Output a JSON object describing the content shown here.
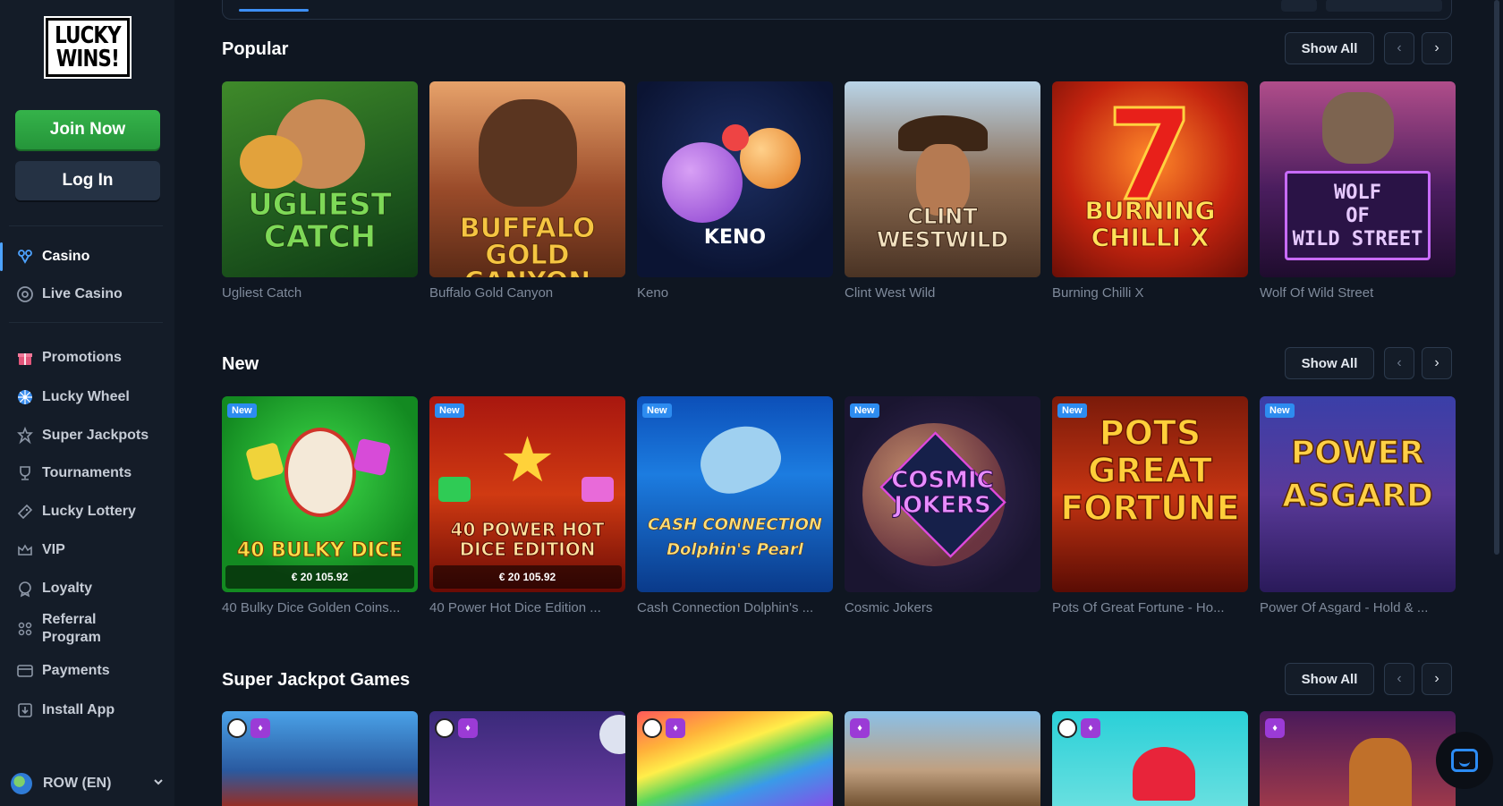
{
  "brand": {
    "logo_line1": "LUCKY",
    "logo_line2": "WINS!"
  },
  "auth": {
    "join_label": "Join Now",
    "login_label": "Log In"
  },
  "sidebar": {
    "primary": [
      {
        "label": "Casino",
        "icon": "casino-icon",
        "active": true
      },
      {
        "label": "Live Casino",
        "icon": "live-casino-icon",
        "active": false
      }
    ],
    "secondary": [
      {
        "label": "Promotions",
        "icon": "gift-icon"
      },
      {
        "label": "Lucky Wheel",
        "icon": "wheel-icon"
      },
      {
        "label": "Super Jackpots",
        "icon": "jackpot-icon"
      },
      {
        "label": "Tournaments",
        "icon": "trophy-icon"
      },
      {
        "label": "Lucky Lottery",
        "icon": "ticket-icon"
      },
      {
        "label": "VIP",
        "icon": "crown-icon"
      },
      {
        "label": "Loyalty",
        "icon": "loyalty-icon"
      },
      {
        "label": "Referral\nProgram",
        "icon": "referral-icon"
      },
      {
        "label": "Payments",
        "icon": "card-icon"
      },
      {
        "label": "Install App",
        "icon": "download-icon"
      }
    ],
    "language": "ROW (EN)"
  },
  "sections": [
    {
      "title": "Popular",
      "show_all": "Show All",
      "games": [
        {
          "name": "Ugliest Catch",
          "art": "UGLIEST\nCATCH"
        },
        {
          "name": "Buffalo Gold Canyon",
          "art": "BUFFALO\nGOLD CANYON"
        },
        {
          "name": "Keno",
          "art": "KENO"
        },
        {
          "name": "Clint West Wild",
          "art": "CLINT\nWESTWILD"
        },
        {
          "name": "Burning Chilli X",
          "art": "BURNING\nCHILLI X"
        },
        {
          "name": "Wolf Of Wild Street",
          "art": "WOLF\nOF\nWILD STREET"
        }
      ]
    },
    {
      "title": "New",
      "show_all": "Show All",
      "badge": "New",
      "games": [
        {
          "name": "40 Bulky Dice Golden Coins...",
          "art": "40 BULKY DICE",
          "jackpot": "€ 20 105.92"
        },
        {
          "name": "40 Power Hot Dice Edition ...",
          "art": "40 POWER HOT\nDICE EDITION",
          "jackpot": "€ 20 105.92"
        },
        {
          "name": "Cash Connection Dolphin's ...",
          "art": "CASH CONNECTION\nDolphin's Pearl"
        },
        {
          "name": "Cosmic Jokers",
          "art": "COSMIC\nJOKERS"
        },
        {
          "name": "Pots Of Great Fortune - Ho...",
          "art": "POTS\nGREAT\nFORTUNE"
        },
        {
          "name": "Power Of Asgard - Hold & ...",
          "art": "POWER\nASGARD"
        }
      ]
    },
    {
      "title": "Super Jackpot Games",
      "show_all": "Show All",
      "games": [
        {
          "name": "",
          "art": ""
        },
        {
          "name": "",
          "art": ""
        },
        {
          "name": "",
          "art": ""
        },
        {
          "name": "",
          "art": ""
        },
        {
          "name": "",
          "art": ""
        },
        {
          "name": "",
          "art": ""
        }
      ]
    }
  ],
  "colors": {
    "bg": "#0f1621",
    "sidebar": "#141c28",
    "accent": "#2d8cf0",
    "join": "#2fa845"
  }
}
